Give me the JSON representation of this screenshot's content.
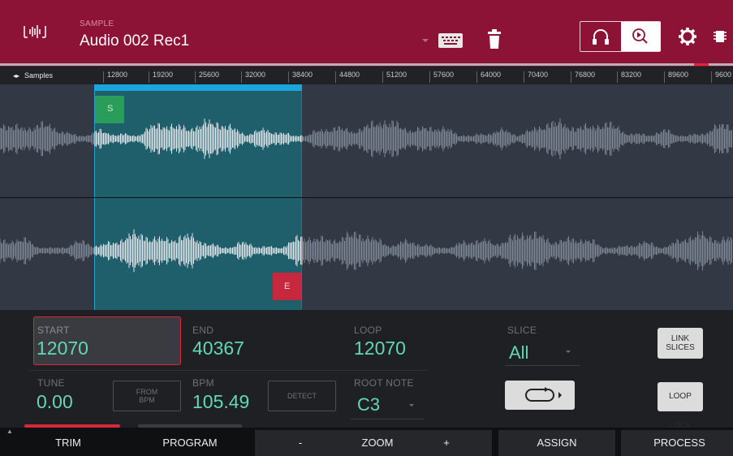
{
  "header": {
    "sample_label": "SAMPLE",
    "sample_name": "Audio 002 Rec1",
    "background": "#8c1336",
    "icons": [
      "waveform-app-icon",
      "keyboard-icon",
      "trash-icon",
      "headphones-icon",
      "zoom-play-icon",
      "gear-icon",
      "chip-icon"
    ]
  },
  "ruler": {
    "title": "Samples",
    "ticks": [
      "12800",
      "19200",
      "25600",
      "32000",
      "38400",
      "44800",
      "51200",
      "57600",
      "64000",
      "70400",
      "76800",
      "83200",
      "89600",
      "9600"
    ]
  },
  "waveform": {
    "start_flag": "S",
    "end_flag": "E",
    "selection_color": "#1e5f6b",
    "selection_top_color": "#1aa5df",
    "start_flag_color": "#2a9d5a",
    "end_flag_color": "#c8283d"
  },
  "params": {
    "start": {
      "label": "START",
      "value": "12070"
    },
    "end": {
      "label": "END",
      "value": "40367"
    },
    "loop": {
      "label": "LOOP",
      "value": "12070"
    },
    "slice": {
      "label": "SLICE",
      "value": "All"
    },
    "tune": {
      "label": "TUNE",
      "value": "0.00"
    },
    "from_bpm": {
      "line1": "FROM",
      "line2": "BPM"
    },
    "bpm": {
      "label": "BPM",
      "value": "105.49"
    },
    "detect": "DETECT",
    "root_note": {
      "label": "ROOT NOTE",
      "value": "C3"
    },
    "link_slices": {
      "line1": "LINK",
      "line2": "SLICES"
    },
    "loop_lock": "LOOP LOCK",
    "value_color": "#63d6b4"
  },
  "tabs": {
    "trim": "TRIM",
    "program": "PROGRAM",
    "zoom_minus": "-",
    "zoom": "ZOOM",
    "zoom_plus": "+",
    "assign": "ASSIGN",
    "process": "PROCESS"
  }
}
